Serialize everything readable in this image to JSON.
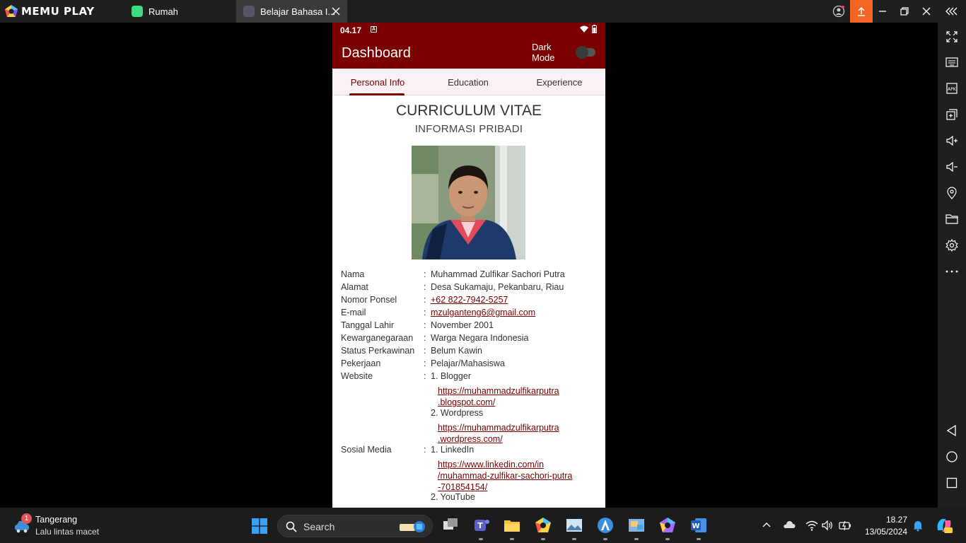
{
  "emulator": {
    "brand": "MEMU PLAY",
    "tabs": [
      {
        "label": "Rumah"
      },
      {
        "label": "Belajar Bahasa I..."
      }
    ]
  },
  "android": {
    "status_time": "04.17",
    "status_a": "A",
    "app_title": "Dashboard",
    "dark_mode_label": "Dark Mode",
    "dark_mode_on": false,
    "tabs": [
      {
        "label": "Personal Info"
      },
      {
        "label": "Education"
      },
      {
        "label": "Experience"
      }
    ],
    "cv_title": "CURRICULUM VITAE",
    "cv_subtitle": "INFORMASI PRIBADI",
    "info": {
      "nama": {
        "label": "Nama",
        "value": "Muhammad Zulfikar Sachori Putra"
      },
      "alamat": {
        "label": "Alamat",
        "value": "Desa Sukamaju, Pekanbaru, Riau"
      },
      "ponsel": {
        "label": "Nomor Ponsel",
        "value": "+62 822-7942-5257"
      },
      "email": {
        "label": "E-mail",
        "value": "mzulganteng6@gmail.com"
      },
      "lahir": {
        "label": "Tanggal Lahir",
        "value": "November 2001"
      },
      "kewarganegaraan": {
        "label": "Kewarganegaraan",
        "value": "Warga Negara Indonesia"
      },
      "status": {
        "label": "Status Perkawinan",
        "value": "Belum Kawin"
      },
      "pekerjaan": {
        "label": "Pekerjaan",
        "value": "Pelajar/Mahasiswa"
      },
      "website": {
        "label": "Website",
        "item1": "1. Blogger",
        "url1_line1": "https://muhammadzulfikarputra",
        "url1_line2": ".blogspot.com/",
        "item2": "2. Wordpress",
        "url2_line1": "https://muhammadzulfikarputra",
        "url2_line2": ".wordpress.com/"
      },
      "sosmed": {
        "label": "Sosial Media",
        "item1": "1. LinkedIn",
        "url1_line1": "https://www.linkedin.com/in",
        "url1_line2": "/muhammad-zulfikar-sachori-putra",
        "url1_line3": "-701854154/",
        "item2": "2. YouTube"
      }
    },
    "colon": ":"
  },
  "taskbar": {
    "weather_title": "Tangerang",
    "weather_sub": "Lalu lintas macet",
    "weather_badge": "1",
    "search_placeholder": "Search",
    "time": "18.27",
    "date": "13/05/2024"
  },
  "colors": {
    "accent": "#7b0000",
    "memu_orange": "#f26522"
  }
}
